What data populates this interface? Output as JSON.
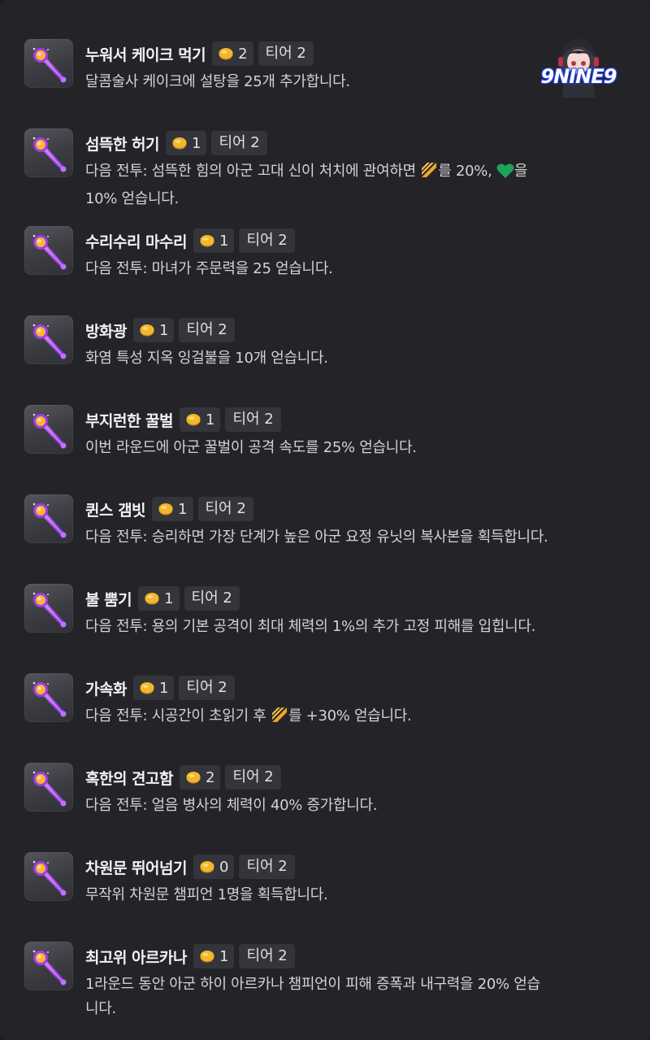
{
  "watermark": {
    "text": "9NINE9"
  },
  "items": [
    {
      "title": "누워서 케이크 먹기",
      "cost": "2",
      "tier": "티어 2",
      "desc": [
        "달콤술사 케이크에 설탕을 25개 추가합니다."
      ]
    },
    {
      "title": "섬뜩한 허기",
      "cost": "1",
      "tier": "티어 2",
      "desc_parts": {
        "a": "다음 전투: 섬뜩한 힘의 아군 고대 신이 처치에 관여하면 ",
        "b": "를 20%, ",
        "c": "을",
        "d": "10% 얻습니다."
      }
    },
    {
      "title": "수리수리 마수리",
      "cost": "1",
      "tier": "티어 2",
      "desc": [
        "다음 전투: 마녀가 주문력을 25 얻습니다."
      ]
    },
    {
      "title": "방화광",
      "cost": "1",
      "tier": "티어 2",
      "desc": [
        "화염 특성 지옥 잉걸불을 10개 얻습니다."
      ]
    },
    {
      "title": "부지런한 꿀벌",
      "cost": "1",
      "tier": "티어 2",
      "desc": [
        "이번 라운드에 아군 꿀벌이 공격 속도를 25% 얻습니다."
      ]
    },
    {
      "title": "퀸스 갬빗",
      "cost": "1",
      "tier": "티어 2",
      "desc": [
        "다음 전투: 승리하면 가장 단계가 높은 아군 요정 유닛의 복사본을 획득합니다."
      ]
    },
    {
      "title": "불 뿜기",
      "cost": "1",
      "tier": "티어 2",
      "desc": [
        "다음 전투: 용의 기본 공격이 최대 체력의 1%의 추가 고정 피해를 입힙니다."
      ]
    },
    {
      "title": "가속화",
      "cost": "1",
      "tier": "티어 2",
      "desc_parts": {
        "a": "다음 전투: 시공간이 초읽기 후 ",
        "b": "를 +30% 얻습니다."
      }
    },
    {
      "title": "혹한의 견고함",
      "cost": "2",
      "tier": "티어 2",
      "desc": [
        "다음 전투: 얼음 병사의 체력이 40% 증가합니다."
      ]
    },
    {
      "title": "차원문 뛰어넘기",
      "cost": "0",
      "tier": "티어 2",
      "desc": [
        "무작위 차원문 챔피언 1명을 획득합니다."
      ]
    },
    {
      "title": "최고위 아르카나",
      "cost": "1",
      "tier": "티어 2",
      "desc": [
        "1라운드 동안 아군 하이 아르카나 챔피언이 피해 증폭과 내구력을 20% 얻습",
        "니다."
      ]
    }
  ],
  "icons": {
    "item": "magic-wand-icon",
    "cost": "gold-coin-icon",
    "attack_speed": "attack-speed-icon",
    "health": "heart-icon"
  },
  "colors": {
    "background": "#242428",
    "badge": "#34353a",
    "gold": "#f0b32b",
    "heart": "#1fa35a"
  }
}
